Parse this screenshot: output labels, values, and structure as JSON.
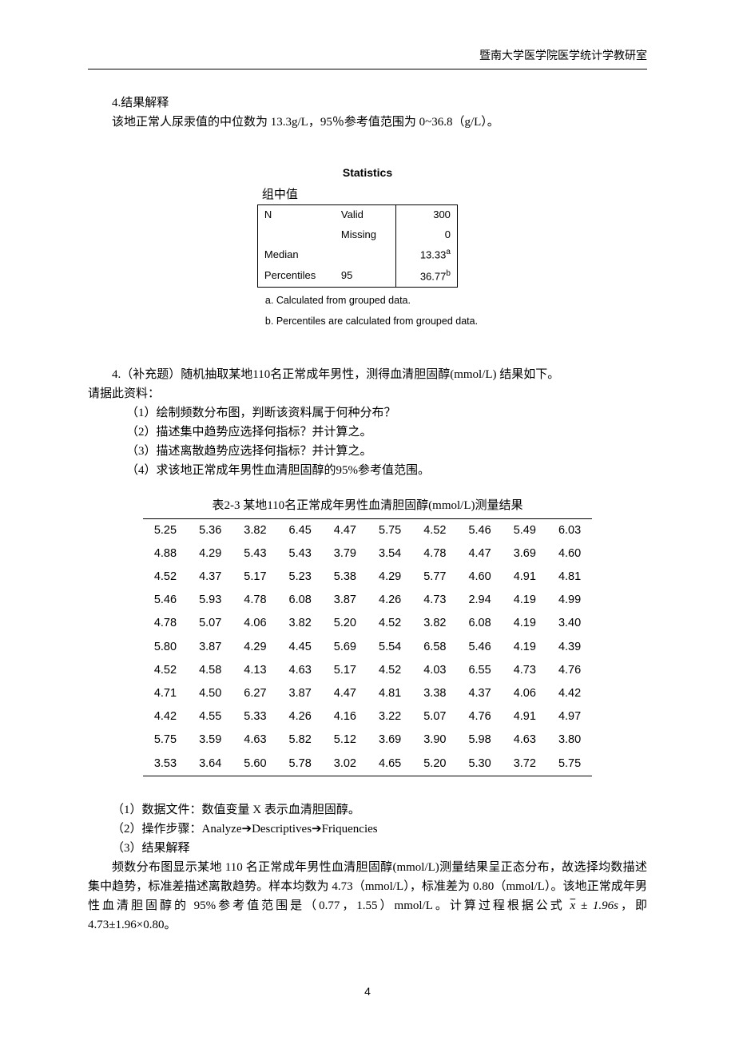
{
  "header": {
    "right": "暨南大学医学院医学统计学教研室"
  },
  "intro": {
    "line1": "4.结果解释",
    "line2": "该地正常人尿汞值的中位数为 13.3g/L，95％参考值范围为 0~36.8（g/L）。"
  },
  "stats": {
    "title": "Statistics",
    "group_label": "组中值",
    "rows": {
      "n": "N",
      "valid_lbl": "Valid",
      "valid_val": "300",
      "missing_lbl": "Missing",
      "missing_val": "0",
      "median_lbl": "Median",
      "median_val": "13.33",
      "median_sup": "a",
      "pct_lbl": "Percentiles",
      "pct_k": "95",
      "pct_val": "36.77",
      "pct_sup": "b"
    },
    "foot_a": "a. Calculated from grouped data.",
    "foot_b": "b. Percentiles are calculated from grouped data."
  },
  "q4": {
    "stem1": "4.（补充题）随机抽取某地110名正常成年男性，测得血清胆固醇(mmol/L) 结果如下。",
    "stem2": "请据此资料：",
    "p1": "（1）绘制频数分布图，判断该资料属于何种分布？",
    "p2": "（2）描述集中趋势应选择何指标？并计算之。",
    "p3": "（3）描述离散趋势应选择何指标？并计算之。",
    "p4": "（4）求该地正常成年男性血清胆固醇的95%参考值范围。"
  },
  "table": {
    "caption": "表2-3 某地110名正常成年男性血清胆固醇(mmol/L)测量结果"
  },
  "chart_data": {
    "type": "table",
    "title": "表2-3 某地110名正常成年男性血清胆固醇(mmol/L)测量结果",
    "columns": 10,
    "rows": [
      [
        "5.25",
        "5.36",
        "3.82",
        "6.45",
        "4.47",
        "5.75",
        "4.52",
        "5.46",
        "5.49",
        "6.03"
      ],
      [
        "4.88",
        "4.29",
        "5.43",
        "5.43",
        "3.79",
        "3.54",
        "4.78",
        "4.47",
        "3.69",
        "4.60"
      ],
      [
        "4.52",
        "4.37",
        "5.17",
        "5.23",
        "5.38",
        "4.29",
        "5.77",
        "4.60",
        "4.91",
        "4.81"
      ],
      [
        "5.46",
        "5.93",
        "4.78",
        "6.08",
        "3.87",
        "4.26",
        "4.73",
        "2.94",
        "4.19",
        "4.99"
      ],
      [
        "4.78",
        "5.07",
        "4.06",
        "3.82",
        "5.20",
        "4.52",
        "3.82",
        "6.08",
        "4.19",
        "3.40"
      ],
      [
        "5.80",
        "3.87",
        "4.29",
        "4.45",
        "5.69",
        "5.54",
        "6.58",
        "5.46",
        "4.19",
        "4.39"
      ],
      [
        "4.52",
        "4.58",
        "4.13",
        "4.63",
        "5.17",
        "4.52",
        "4.03",
        "6.55",
        "4.73",
        "4.76"
      ],
      [
        "4.71",
        "4.50",
        "6.27",
        "3.87",
        "4.47",
        "4.81",
        "3.38",
        "4.37",
        "4.06",
        "4.42"
      ],
      [
        "4.42",
        "4.55",
        "5.33",
        "4.26",
        "4.16",
        "3.22",
        "5.07",
        "4.76",
        "4.91",
        "4.97"
      ],
      [
        "5.75",
        "3.59",
        "4.63",
        "5.82",
        "5.12",
        "3.69",
        "3.90",
        "5.98",
        "4.63",
        "3.80"
      ],
      [
        "3.53",
        "3.64",
        "5.60",
        "5.78",
        "3.02",
        "4.65",
        "5.20",
        "5.30",
        "3.72",
        "5.75"
      ]
    ]
  },
  "ans": {
    "a1": "（1）数据文件：数值变量 X 表示血清胆固醇。",
    "a2_pre": "（2）操作步骤：Analyze",
    "a2_mid1": "Descriptives",
    "a2_mid2": "Friquencies",
    "a3": "（3）结果解释",
    "para": "频数分布图显示某地 110 名正常成年男性血清胆固醇(mmol/L)测量结果呈正态分布，故选择均数描述集中趋势，标准差描述离散趋势。样本均数为 4.73（mmol/L），标准差为 0.80（mmol/L）。该地正常成年男性血清胆固醇的 95%参考值范围是（0.77，1.55）mmol/L。计算过程根据公式",
    "formula_tail": "，即 4.73±1.96×0.80。"
  },
  "pagenum": "4"
}
